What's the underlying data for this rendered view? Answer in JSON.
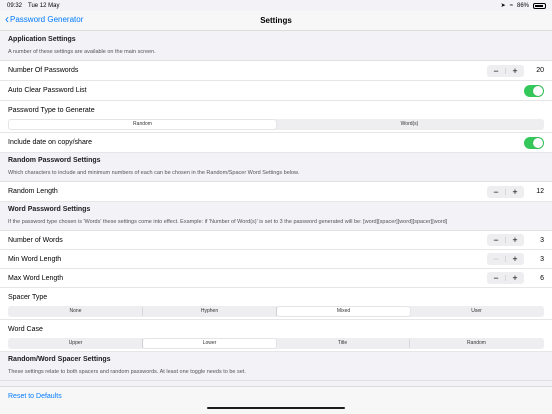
{
  "status_bar": {
    "time": "09:32",
    "date": "Tue 12 May",
    "battery": "86%",
    "icons": [
      "wifi-icon",
      "location-icon",
      "battery-icon"
    ]
  },
  "nav": {
    "back_label": "Password Generator",
    "title": "Settings"
  },
  "application": {
    "header": "Application Settings",
    "description": "A number of these settings are available on the main screen.",
    "num_passwords_label": "Number Of Passwords",
    "num_passwords_value": "20",
    "auto_clear_label": "Auto Clear Password List",
    "auto_clear_on": true,
    "password_type_label": "Password Type to Generate",
    "password_type_options": [
      "Random",
      "Word(s)"
    ],
    "password_type_selected": "Random",
    "include_date_label": "Include date on copy/share",
    "include_date_on": true
  },
  "random": {
    "header": "Random Password Settings",
    "description": "Which characters to include and minimum numbers of each can be chosen in the Random/Spacer Word Settings below.",
    "length_label": "Random Length",
    "length_value": "12"
  },
  "word": {
    "header": "Word Password Settings",
    "description": "If the password type chosen is 'Words' these settings come into effect. Example: if 'Number of Word(s)' is set to 3 the password generated will be: [word][spacer][word][spacer][word]",
    "num_words_label": "Number of Words",
    "num_words_value": "3",
    "min_len_label": "Min Word Length",
    "min_len_value": "3",
    "max_len_label": "Max Word Length",
    "max_len_value": "6",
    "spacer_type_label": "Spacer Type",
    "spacer_options": [
      "None",
      "Hyphen",
      "Mixed",
      "User"
    ],
    "spacer_selected": "Mixed",
    "word_case_label": "Word Case",
    "case_options": [
      "Upper",
      "Lower",
      "Title",
      "Random"
    ],
    "case_selected": "Lower"
  },
  "spacer": {
    "header": "Random/Word Spacer Settings",
    "description": "These settings relate to both spacers and random passwords. At least one toggle needs to be set."
  },
  "stepper": {
    "minus": "−",
    "plus": "+"
  },
  "bottom": {
    "reset_label": "Reset to Defaults"
  }
}
